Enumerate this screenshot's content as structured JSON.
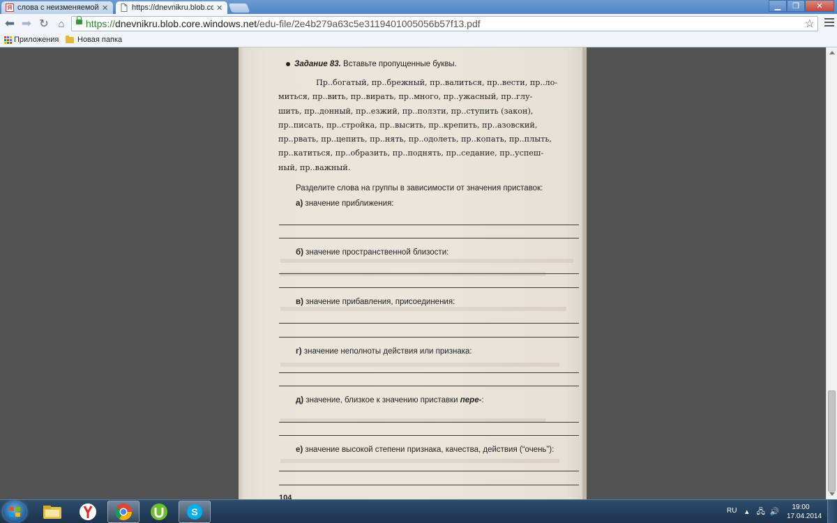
{
  "browser": {
    "tabs": [
      {
        "title": "слова с неизменяемой п",
        "favicon": "yandex-icon",
        "active": false
      },
      {
        "title": "https://dnevnikru.blob.co",
        "favicon": "page-icon",
        "active": true
      }
    ],
    "url": {
      "scheme": "https://",
      "host": "dnevnikru.blob.core.windows.net",
      "path": "/edu-file/2e4b279a63c5e3119401005056b57f13.pdf"
    },
    "bookmarks": [
      {
        "label": "Приложения",
        "icon": "apps-grid-icon"
      },
      {
        "label": "Новая папка",
        "icon": "folder-icon"
      }
    ]
  },
  "document": {
    "task_number": "Задание 83.",
    "task_text": " Вставьте пропущенные буквы.",
    "body_lines": [
      "Пр..богатый, пр..брежный, пр..валиться, пр..вести, пр..ло-",
      "миться, пр..вить, пр..вирать, пр..много, пр..ужасный, пр..глу-",
      "шить, пр..донный, пр..езжий, пр..ползти, пр..ступить (закон),",
      "пр..писать, пр..стройка, пр..высить, пр..крепить, пр..азовский,",
      "пр..рвать, пр..цепить, пр..нять, пр..одолеть, пр..копать, пр..плыть,",
      "пр..катиться, пр..образить, пр..поднять, пр..седание, пр..успеш-",
      "ный, пр..важный."
    ],
    "instruction": "Разделите слова на группы в зависимости от значения приставок:",
    "groups": [
      {
        "letter": "а)",
        "text": " значение приближения:",
        "extra_bold": "",
        "extra_tail": ""
      },
      {
        "letter": "б)",
        "text": " значение пространственной близости:",
        "extra_bold": "",
        "extra_tail": ""
      },
      {
        "letter": "в)",
        "text": " значение прибавления, присоединения:",
        "extra_bold": "",
        "extra_tail": ""
      },
      {
        "letter": "г)",
        "text": " значение неполноты действия или признака:",
        "extra_bold": "",
        "extra_tail": ""
      },
      {
        "letter": "д)",
        "text": " значение, близкое к значению приставки ",
        "extra_bold": "пере-",
        "extra_tail": ":"
      },
      {
        "letter": "е)",
        "text": " значение высокой степени признака, качества, действия (“очень”):",
        "extra_bold": "",
        "extra_tail": ""
      }
    ],
    "page_number": "104"
  },
  "taskbar": {
    "apps": [
      "explorer-icon",
      "yandex-browser-icon",
      "chrome-icon",
      "utorrent-icon",
      "skype-icon"
    ],
    "language": "RU",
    "time": "19:00",
    "date": "17.04.2014"
  },
  "colors": {
    "titlebar": "#4f86c5",
    "url_host": "#2b8a2b",
    "page_paper": "#ebe6dd",
    "viewer_bg": "#525252",
    "taskbar": "#1b324b"
  }
}
